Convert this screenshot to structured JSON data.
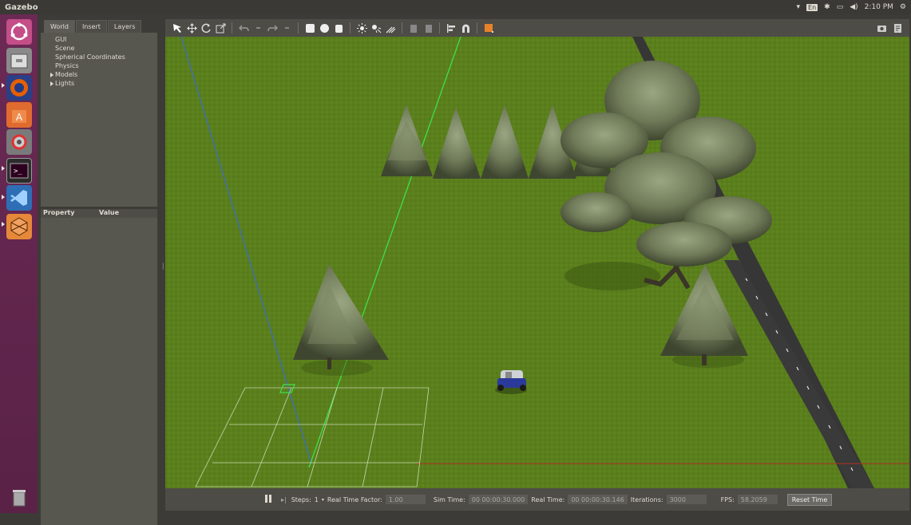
{
  "window": {
    "title": "Gazebo"
  },
  "tray": {
    "lang": "En",
    "time": "2:10 PM"
  },
  "launcher": {
    "apps": [
      {
        "name": "ubuntu-dash-icon"
      },
      {
        "name": "files-icon"
      },
      {
        "name": "firefox-icon"
      },
      {
        "name": "software-center-icon"
      },
      {
        "name": "system-settings-icon"
      },
      {
        "name": "terminal-icon"
      },
      {
        "name": "vscode-icon"
      },
      {
        "name": "gazebo-icon"
      }
    ]
  },
  "left_panel": {
    "tabs": [
      {
        "label": "World",
        "active": true
      },
      {
        "label": "Insert",
        "active": false
      },
      {
        "label": "Layers",
        "active": false
      }
    ],
    "tree": [
      {
        "label": "GUI",
        "expandable": false
      },
      {
        "label": "Scene",
        "expandable": false
      },
      {
        "label": "Spherical Coordinates",
        "expandable": false
      },
      {
        "label": "Physics",
        "expandable": false
      },
      {
        "label": "Models",
        "expandable": true
      },
      {
        "label": "Lights",
        "expandable": true
      }
    ],
    "props_header": {
      "property": "Property",
      "value": "Value"
    }
  },
  "toolbar": {
    "tools": [
      "select-arrow-icon",
      "translate-icon",
      "rotate-icon",
      "scale-icon",
      "undo-icon",
      "redo-icon",
      "box-icon",
      "sphere-icon",
      "cylinder-icon",
      "point-light-icon",
      "spot-light-icon",
      "directional-light-icon",
      "copy-icon",
      "paste-icon",
      "align-icon",
      "snap-icon",
      "orange-select-icon"
    ],
    "right": [
      "screenshot-icon",
      "log-icon"
    ]
  },
  "bottom": {
    "steps_label": "Steps:",
    "steps_value": "1",
    "rtf_label": "Real Time Factor:",
    "rtf_value": "1.00",
    "sim_label": "Sim Time:",
    "sim_value": "00 00:00:30.000",
    "real_label": "Real Time:",
    "real_value": "00 00:00:30.146",
    "iter_label": "Iterations:",
    "iter_value": "3000",
    "fps_label": "FPS:",
    "fps_value": "58.2059",
    "reset_label": "Reset Time"
  },
  "colors": {
    "ground": "#5a7f1c",
    "road": "#3a3a3a",
    "launcher": "#6b2a54"
  }
}
